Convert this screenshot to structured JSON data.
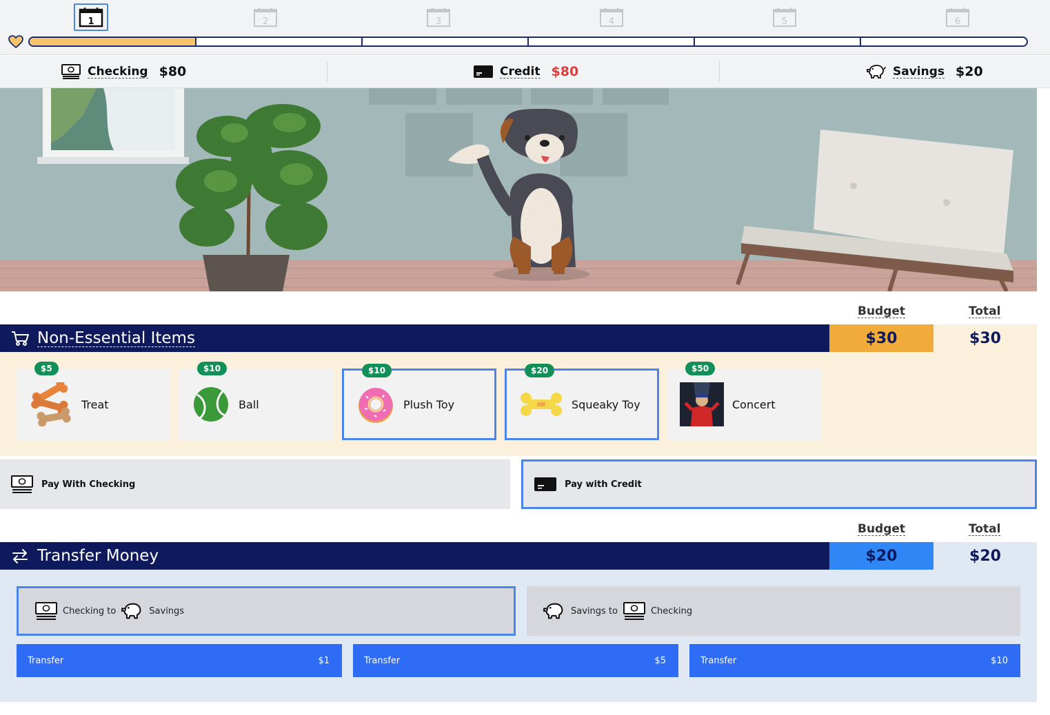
{
  "timeline": {
    "days": [
      "1",
      "2",
      "3",
      "4",
      "5",
      "6"
    ],
    "active_day": "1",
    "progress": 0.1667
  },
  "balances": {
    "checking": {
      "label": "Checking",
      "amount": "$80"
    },
    "credit": {
      "label": "Credit",
      "amount": "$80"
    },
    "savings": {
      "label": "Savings",
      "amount": "$20"
    }
  },
  "nonessential": {
    "title": "Non-Essential Items",
    "budget_header": "Budget",
    "total_header": "Total",
    "budget": "$30",
    "total": "$30",
    "items": [
      {
        "name": "Treat",
        "price": "$5",
        "selected": false
      },
      {
        "name": "Ball",
        "price": "$10",
        "selected": false
      },
      {
        "name": "Plush Toy",
        "price": "$10",
        "selected": true
      },
      {
        "name": "Squeaky Toy",
        "price": "$20",
        "selected": true
      },
      {
        "name": "Concert",
        "price": "$50",
        "selected": false
      }
    ],
    "pay_checking": "Pay With Checking",
    "pay_credit": "Pay with Credit"
  },
  "transfer": {
    "title": "Transfer Money",
    "budget_header": "Budget",
    "total_header": "Total",
    "budget": "$20",
    "total": "$20",
    "checking_to_savings": {
      "from": "Checking to",
      "to": "Savings"
    },
    "savings_to_checking": {
      "from": "Savings to",
      "to": "Checking"
    },
    "buttons": [
      {
        "label": "Transfer",
        "amount": "$1"
      },
      {
        "label": "Transfer",
        "amount": "$5"
      },
      {
        "label": "Transfer",
        "amount": "$10"
      }
    ]
  },
  "colors": {
    "navy": "#0f1a5c",
    "accent_blue": "#4a86e8",
    "budget_orange": "#f0ab3a",
    "budget_blue": "#2f86f5",
    "price_green": "#13905a",
    "credit_red": "#e03c3c"
  }
}
